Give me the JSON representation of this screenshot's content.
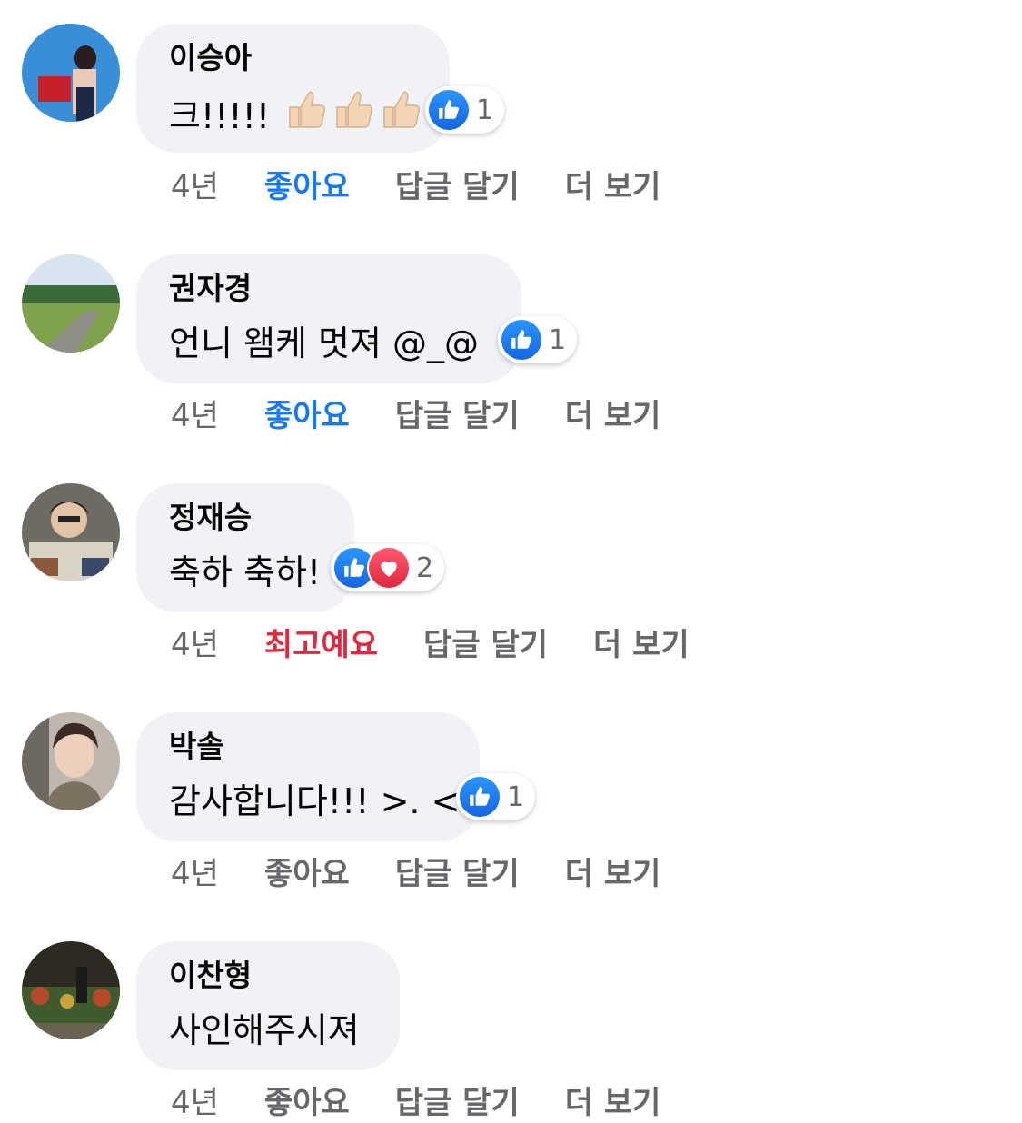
{
  "comments": [
    {
      "author": "이승아",
      "text": "크!!!!!",
      "emoji": "👍👍👍",
      "reactions": {
        "types": [
          "like-icon"
        ],
        "count": "1"
      },
      "time": "4년",
      "reaction_label": "좋아요",
      "reply_label": "답글 달기",
      "more_label": "더 보기",
      "reaction_state": "liked"
    },
    {
      "author": "권자경",
      "text": "언니 왬케 멋져 @_@",
      "reactions": {
        "types": [
          "like-icon"
        ],
        "count": "1"
      },
      "time": "4년",
      "reaction_label": "좋아요",
      "reply_label": "답글 달기",
      "more_label": "더 보기",
      "reaction_state": "liked"
    },
    {
      "author": "정재승",
      "text": "축하 축하!",
      "reactions": {
        "types": [
          "like-icon",
          "love-icon"
        ],
        "count": "2"
      },
      "time": "4년",
      "reaction_label": "최고예요",
      "reply_label": "답글 달기",
      "more_label": "더 보기",
      "reaction_state": "loved"
    },
    {
      "author": "박솔",
      "text": "감사합니다!!! >. <",
      "reactions": {
        "types": [
          "like-icon"
        ],
        "count": "1"
      },
      "time": "4년",
      "reaction_label": "좋아요",
      "reply_label": "답글 달기",
      "more_label": "더 보기",
      "reaction_state": "none"
    },
    {
      "author": "이찬형",
      "text": "사인해주시져",
      "time": "4년",
      "reaction_label": "좋아요",
      "reply_label": "답글 달기",
      "more_label": "더 보기",
      "reaction_state": "none"
    }
  ],
  "colors": {
    "bubble": "#f0f2f5",
    "meta": "#65676b",
    "like": "#1877f2",
    "love": "#e0283f"
  }
}
